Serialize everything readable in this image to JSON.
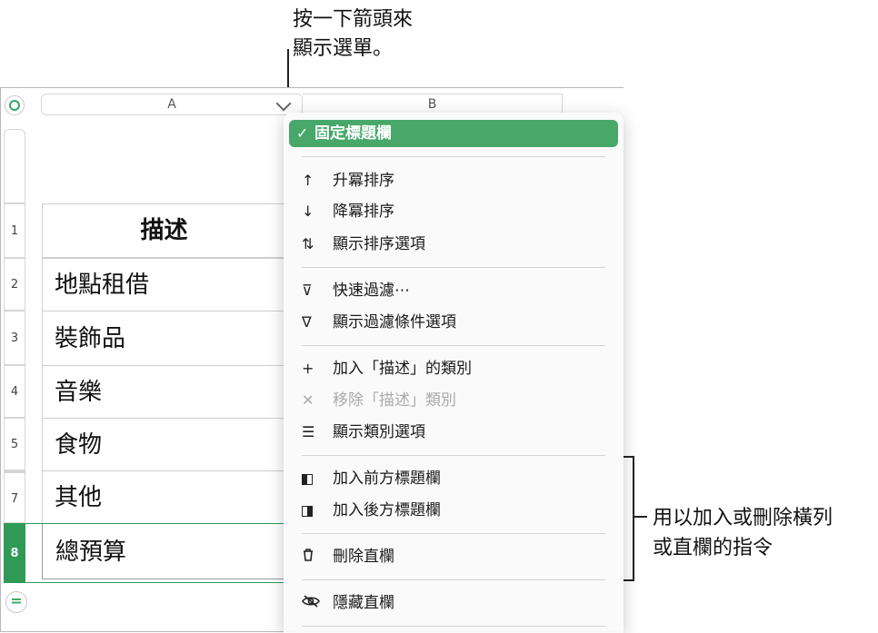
{
  "annotations": {
    "top": [
      "按一下箭頭來",
      "顯示選單。"
    ],
    "right": [
      "用以加入或刪除橫列",
      "或直欄的指令"
    ]
  },
  "columns": {
    "a": "A",
    "b": "B"
  },
  "rows": {
    "header_num": "1",
    "numbers": [
      "2",
      "3",
      "4",
      "5",
      "7"
    ],
    "total_num": "8",
    "header_cell": "描述",
    "cells": [
      "地點租借",
      "裝飾品",
      "音樂",
      "食物",
      "其他"
    ],
    "total_cell": "總預算"
  },
  "menu": {
    "freeze": {
      "icon": "checkmark",
      "glyph": "✓",
      "label": "固定標題欄"
    },
    "sort_asc": {
      "icon": "arrow-up-icon",
      "glyph": "↑",
      "label": "升冪排序"
    },
    "sort_desc": {
      "icon": "arrow-down-icon",
      "glyph": "↓",
      "label": "降冪排序"
    },
    "sort_options": {
      "icon": "sort-arrows-icon",
      "glyph": "⇅",
      "label": "顯示排序選項"
    },
    "quick_filter": {
      "icon": "quick-filter-icon",
      "glyph": "⊽",
      "label": "快速過濾⋯"
    },
    "filter_options": {
      "icon": "filter-icon",
      "glyph": "∇",
      "label": "顯示過濾條件選項"
    },
    "add_category": {
      "icon": "plus-icon",
      "glyph": "+",
      "label": "加入「描述」的類別"
    },
    "remove_category": {
      "icon": "x-icon",
      "glyph": "✕",
      "label": "移除「描述」類別",
      "disabled": true
    },
    "category_options": {
      "icon": "list-icon",
      "glyph": "☰",
      "label": "顯示類別選項"
    },
    "add_col_before": {
      "icon": "add-column-before-icon",
      "label": "加入前方標題欄"
    },
    "add_col_after": {
      "icon": "add-column-after-icon",
      "label": "加入後方標題欄"
    },
    "delete_col": {
      "icon": "trash-icon",
      "glyph": "🗑",
      "label": "刪除直欄"
    },
    "hide_col": {
      "icon": "eye-slash-icon",
      "glyph": "◌",
      "label": "隱藏直欄"
    }
  },
  "colors": {
    "accent": "#47a86a",
    "selected_row": "#2f9a55"
  }
}
